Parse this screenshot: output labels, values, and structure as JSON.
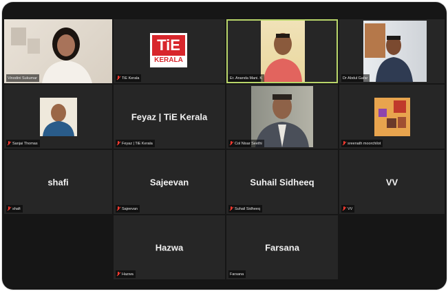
{
  "meeting": {
    "participants": [
      {
        "id": "p1",
        "name": "Vinodini Sukumar",
        "label": "Vinodini Sukumar",
        "muted": false,
        "video": true
      },
      {
        "id": "p2",
        "name": "TiE Kerala",
        "label": "TiE Kerala",
        "muted": true,
        "video": true,
        "logo_text": "TiE",
        "logo_sub": "KERALA"
      },
      {
        "id": "p3",
        "name": "Er. Ananda Mani. K",
        "label": "Er. Ananda Mani. K",
        "muted": false,
        "video": true,
        "active_speaker": true
      },
      {
        "id": "p4",
        "name": "Dr Abdul Gafar",
        "label": "Dr Abdul Gafar",
        "muted": false,
        "video": true
      },
      {
        "id": "p5",
        "name": "Sanjai Thomas",
        "label": "Sanjai Thomas",
        "muted": true,
        "video": true
      },
      {
        "id": "p6",
        "name": "Feyaz | TiE Kerala",
        "label": "Feyaz | TiE Kerala",
        "muted": true,
        "video": false
      },
      {
        "id": "p7",
        "name": "Col Nisar Seethi",
        "label": "Col Nisar Seethi",
        "muted": true,
        "video": true
      },
      {
        "id": "p8",
        "name": "sreenath moorchilot",
        "label": "sreenath moorchilot",
        "muted": true,
        "video": true
      },
      {
        "id": "p9",
        "name": "shafi",
        "label": "shafi",
        "muted": true,
        "video": false
      },
      {
        "id": "p10",
        "name": "Sajeevan",
        "label": "Sajeevan",
        "muted": true,
        "video": false
      },
      {
        "id": "p11",
        "name": "Suhail Sidheeq",
        "label": "Suhail Sidheeq",
        "muted": true,
        "video": false
      },
      {
        "id": "p12",
        "name": "VV",
        "label": "VV",
        "muted": true,
        "video": false
      },
      {
        "id": "p13",
        "name": "Hazwa",
        "label": "Hazwa",
        "muted": true,
        "video": false
      },
      {
        "id": "p14",
        "name": "Farsana",
        "label": "Farsana",
        "muted": false,
        "video": false
      }
    ]
  },
  "colors": {
    "active_speaker_border": "#b9d66a",
    "muted_icon": "#ff3b30",
    "tile_bg": "#262626",
    "frame_bg": "#161616",
    "tie_red": "#d8262c"
  }
}
